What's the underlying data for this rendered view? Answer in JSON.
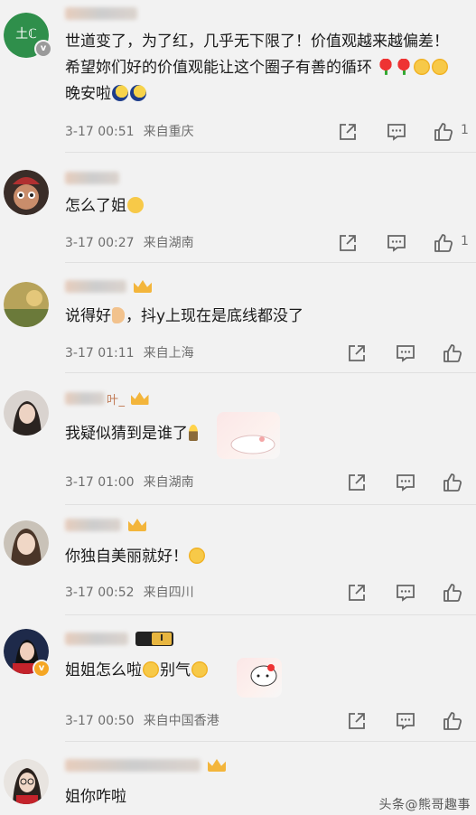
{
  "comments": [
    {
      "name_suffix": "",
      "text": "世道变了，为了红，几乎无下限了！价值观越来越偏差！希望妳们好的价值观能让这个圈子有善的循环",
      "text_tail": "晚安啦",
      "time": "3-17 00:51",
      "location": "来自重庆",
      "likes": "1"
    },
    {
      "name_suffix": "",
      "text": "怎么了姐",
      "time": "3-17 00:27",
      "location": "来自湖南",
      "likes": "1"
    },
    {
      "name_suffix": "",
      "text": "说得好",
      "text_tail": "，抖y上现在是底线都没了",
      "time": "3-17 01:11",
      "location": "来自上海",
      "likes": ""
    },
    {
      "name_suffix": "叶_",
      "text": "我疑似猜到是谁了",
      "time": "3-17 01:00",
      "location": "来自湖南",
      "likes": ""
    },
    {
      "name_suffix": "",
      "text": "你独自美丽就好！",
      "time": "3-17 00:52",
      "location": "来自四川",
      "likes": ""
    },
    {
      "name_suffix": "",
      "text": "姐姐怎么啦",
      "text_tail": "别气",
      "time": "3-17 00:50",
      "location": "来自中国香港",
      "likes": ""
    },
    {
      "name_suffix": "",
      "text": "姐你咋啦",
      "time": "",
      "location": "",
      "likes": ""
    }
  ],
  "badge_level": "I",
  "watermark": "头条@熊哥趣事",
  "colors": {
    "background": "#f2f2f2",
    "meta": "#6e6e6e",
    "name": "#c07a55",
    "accent": "#f3b53b"
  },
  "icons": [
    "share-icon",
    "comment-icon",
    "like-icon"
  ]
}
